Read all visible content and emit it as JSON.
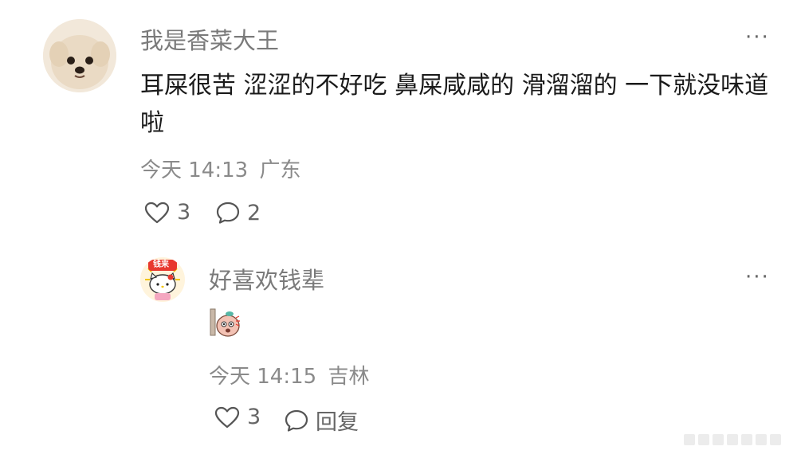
{
  "comment": {
    "username": "我是香菜大王",
    "text": "耳屎很苦 涩涩的不好吃 鼻屎咸咸的 滑溜溜的 一下就没味道啦",
    "time": "今天 14:13",
    "location": "广东",
    "likes": "3",
    "replies": "2",
    "avatar_icon": "dog-avatar-icon"
  },
  "reply": {
    "username": "好喜欢钱辈",
    "sticker_icon": "peeking-character-sticker",
    "time": "今天 14:15",
    "location": "吉林",
    "likes": "3",
    "reply_label": "回复",
    "avatar_icon": "hello-kitty-avatar-icon",
    "avatar_text": "钱来"
  },
  "more_label": "···",
  "colors": {
    "accent_red": "#e8382e",
    "icon_gray": "#555555",
    "meta_gray": "#8a8a8a"
  }
}
